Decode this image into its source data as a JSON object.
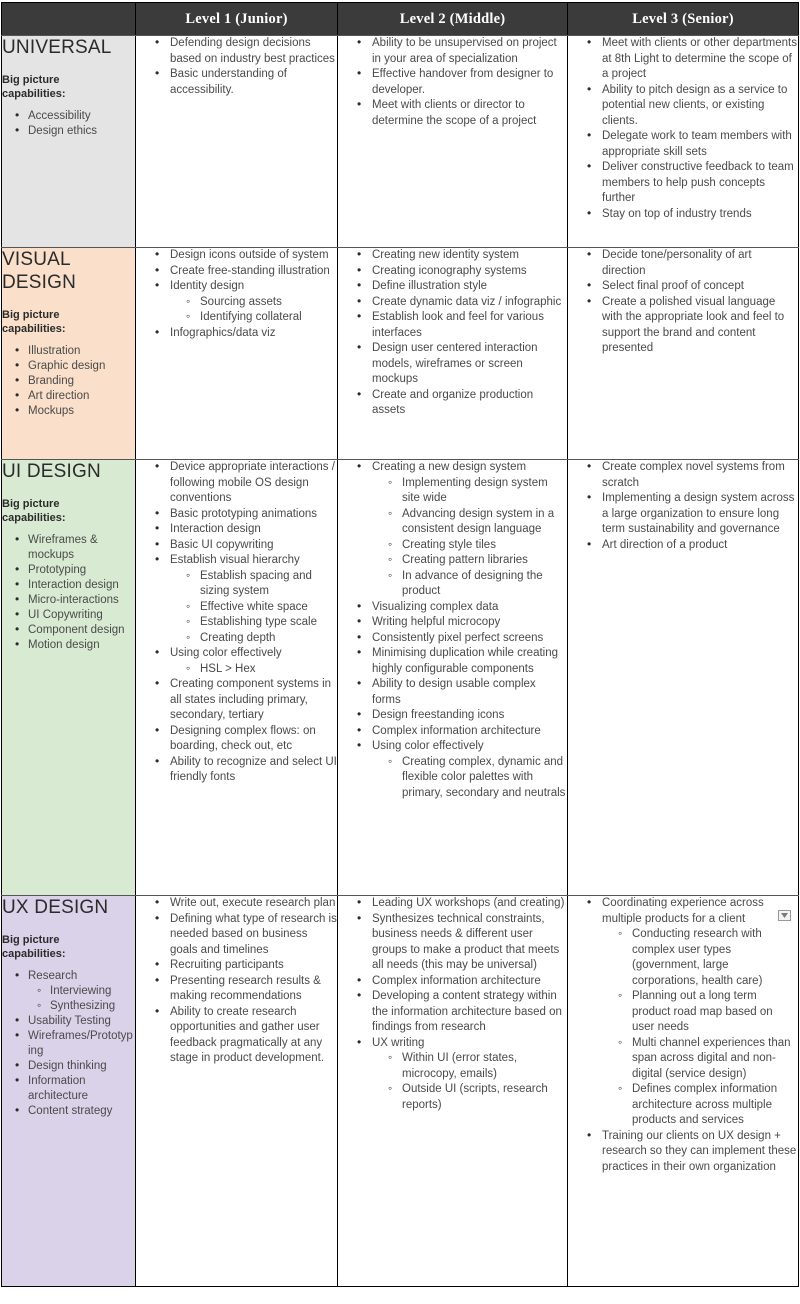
{
  "table": {
    "corner_label": "",
    "columns": [
      {
        "id": "category",
        "label": ""
      },
      {
        "id": "level1",
        "label": "Level 1 (Junior)"
      },
      {
        "id": "level2",
        "label": "Level 2 (Middle)"
      },
      {
        "id": "level3",
        "label": "Level 3 (Senior)"
      }
    ],
    "capabilities_heading": "Big picture capabilities:",
    "rows": [
      {
        "id": "universal",
        "title": "UNIVERSAL",
        "tint": "#e4e4e4",
        "capabilities": [
          {
            "text": "Accessibility"
          },
          {
            "text": "Design ethics"
          }
        ],
        "level1": [
          {
            "text": "Defending design decisions based on industry best practices"
          },
          {
            "text": "Basic understanding of accessibility."
          }
        ],
        "level2": [
          {
            "text": "Ability to be unsupervised on project in your area of specialization"
          },
          {
            "text": "Effective handover from designer to developer."
          },
          {
            "text": "Meet with clients or director to determine the scope of a project"
          }
        ],
        "level3": [
          {
            "text": "Meet with clients or other departments at 8th Light to determine the scope of a project"
          },
          {
            "text": "Ability to pitch design as a service to potential new clients, or existing clients."
          },
          {
            "text": "Delegate work to team members with appropriate skill sets"
          },
          {
            "text": "Deliver constructive feedback to team members to help push concepts further"
          },
          {
            "text": "Stay on top of industry trends"
          }
        ]
      },
      {
        "id": "visual-design",
        "title": "VISUAL DESIGN",
        "tint": "#fae0ca",
        "capabilities": [
          {
            "text": "Illustration"
          },
          {
            "text": "Graphic design"
          },
          {
            "text": "Branding"
          },
          {
            "text": "Art direction"
          },
          {
            "text": "Mockups"
          }
        ],
        "level1": [
          {
            "text": "Design icons outside of system"
          },
          {
            "text": "Create free-standing illustration"
          },
          {
            "text": "Identity design",
            "sub": [
              {
                "text": "Sourcing assets"
              },
              {
                "text": "Identifying collateral"
              }
            ]
          },
          {
            "text": "Infographics/data viz"
          }
        ],
        "level2": [
          {
            "text": "Creating new identity system"
          },
          {
            "text": "Creating iconography systems"
          },
          {
            "text": "Define illustration style"
          },
          {
            "text": "Create dynamic data viz / infographic"
          },
          {
            "text": "Establish look and feel for various interfaces"
          },
          {
            "text": "Design user centered interaction models, wireframes or screen mockups"
          },
          {
            "text": "Create and organize production assets"
          }
        ],
        "level3": [
          {
            "text": "Decide tone/personality of art direction"
          },
          {
            "text": "Select final proof of concept"
          },
          {
            "text": "Create a polished visual language with the appropriate look and feel to support the brand and content presented"
          }
        ]
      },
      {
        "id": "ui-design",
        "title": "UI DESIGN",
        "tint": "#d9ead3",
        "capabilities": [
          {
            "text": "Wireframes & mockups"
          },
          {
            "text": "Prototyping"
          },
          {
            "text": "Interaction design"
          },
          {
            "text": "Micro-interactions"
          },
          {
            "text": "UI Copywriting"
          },
          {
            "text": "Component design"
          },
          {
            "text": "Motion design"
          }
        ],
        "level1": [
          {
            "text": "Device appropriate interactions / following mobile OS design conventions"
          },
          {
            "text": "Basic prototyping animations"
          },
          {
            "text": "Interaction design"
          },
          {
            "text": "Basic UI copywriting"
          },
          {
            "text": "Establish visual hierarchy",
            "sub": [
              {
                "text": "Establish spacing and sizing system"
              },
              {
                "text": "Effective white space"
              },
              {
                "text": "Establishing type scale"
              },
              {
                "text": "Creating depth"
              }
            ]
          },
          {
            "text": "Using color effectively",
            "sub": [
              {
                "text": "HSL > Hex"
              }
            ]
          },
          {
            "text": "Creating component systems in all states including primary, secondary, tertiary"
          },
          {
            "text": "Designing complex flows: on boarding, check out, etc"
          },
          {
            "text": "Ability to recognize and select UI friendly fonts"
          }
        ],
        "level2": [
          {
            "text": "Creating a new design system",
            "sub": [
              {
                "text": "Implementing design system site wide"
              },
              {
                "text": "Advancing design system in a consistent design language"
              },
              {
                "text": "Creating style tiles"
              },
              {
                "text": "Creating pattern libraries"
              },
              {
                "text": "In advance of designing the product"
              }
            ]
          },
          {
            "text": "Visualizing complex data"
          },
          {
            "text": "Writing helpful microcopy"
          },
          {
            "text": "Consistently pixel perfect screens"
          },
          {
            "text": "Minimising duplication while creating highly configurable components"
          },
          {
            "text": "Ability to design usable complex forms"
          },
          {
            "text": "Design freestanding icons"
          },
          {
            "text": "Complex information architecture"
          },
          {
            "text": "Using color effectively",
            "sub": [
              {
                "text": "Creating complex, dynamic and flexible color palettes with primary, secondary and neutrals"
              }
            ]
          }
        ],
        "level3": [
          {
            "text": "Create complex novel systems from scratch"
          },
          {
            "text": "Implementing a design system across a large organization to ensure long term sustainability and governance"
          },
          {
            "text": "Art direction of a product"
          }
        ]
      },
      {
        "id": "ux-design",
        "title": "UX DESIGN",
        "tint": "#d9d2e9",
        "capabilities": [
          {
            "text": "Research",
            "sub": [
              {
                "text": "Interviewing"
              },
              {
                "text": "Synthesizing"
              }
            ]
          },
          {
            "text": "Usability Testing"
          },
          {
            "text": "Wireframes/Prototyping"
          },
          {
            "text": "Design thinking"
          },
          {
            "text": "Information architecture"
          },
          {
            "text": "Content strategy"
          }
        ],
        "level1": [
          {
            "text": "Write out, execute research plan"
          },
          {
            "text": "Defining what type of research is needed based on business goals and timelines"
          },
          {
            "text": "Recruiting participants"
          },
          {
            "text": "Presenting research results & making recommendations"
          },
          {
            "text": "Ability to create research opportunities and gather user feedback pragmatically at any stage in product development."
          }
        ],
        "level2": [
          {
            "text": "Leading UX workshops (and creating)"
          },
          {
            "text": "Synthesizes technical constraints, business needs & different user groups to make a product that meets all needs (this may be universal)"
          },
          {
            "text": "Complex information architecture"
          },
          {
            "text": "Developing a content strategy within the information architecture based on findings from research"
          },
          {
            "text": "UX writing",
            "sub": [
              {
                "text": "Within UI (error states, microcopy, emails)"
              },
              {
                "text": "Outside UI (scripts, research reports)"
              }
            ]
          }
        ],
        "level3": [
          {
            "text": "Coordinating experience across multiple products for a client",
            "sub": [
              {
                "text": "Conducting research with complex user types (government, large corporations, health care)"
              },
              {
                "text": "Planning out a long term product road map based on user needs"
              },
              {
                "text": "Multi channel experiences than span across digital and non-digital (service design)"
              },
              {
                "text": "Defines complex information architecture across multiple products and services"
              }
            ]
          },
          {
            "text": "Training our clients on UX design + research so they can implement these practices in their own organization"
          }
        ]
      }
    ]
  },
  "overlay": {
    "filter_dropdown_icon": "chevron-down-icon"
  }
}
